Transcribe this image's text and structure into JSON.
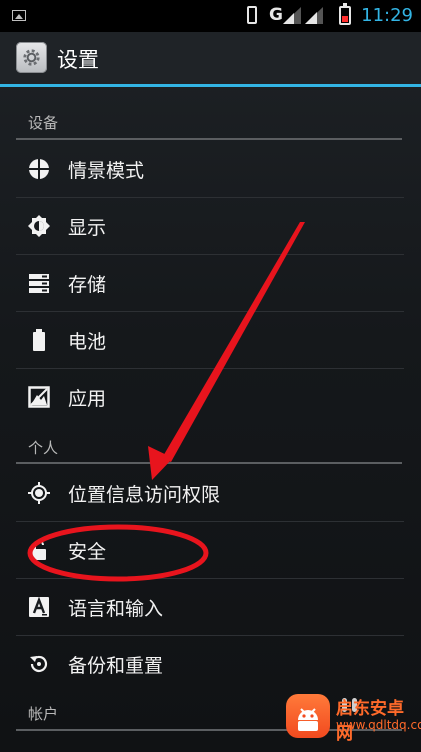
{
  "status_bar": {
    "time": "11:29",
    "network_label": "G",
    "time_color": "#33b5e5",
    "battery_level_fraction": 0.3
  },
  "action_bar": {
    "title": "设置",
    "accent_color": "#33b5e5"
  },
  "sections": [
    {
      "header": "设备",
      "items": [
        {
          "label": "情景模式",
          "icon": "profiles-icon"
        },
        {
          "label": "显示",
          "icon": "display-icon"
        },
        {
          "label": "存储",
          "icon": "storage-icon"
        },
        {
          "label": "电池",
          "icon": "battery-icon"
        },
        {
          "label": "应用",
          "icon": "apps-icon"
        }
      ]
    },
    {
      "header": "个人",
      "items": [
        {
          "label": "位置信息访问权限",
          "icon": "location-icon"
        },
        {
          "label": "安全",
          "icon": "lock-icon"
        },
        {
          "label": "语言和输入",
          "icon": "language-icon"
        },
        {
          "label": "备份和重置",
          "icon": "backup-icon"
        }
      ]
    },
    {
      "header": "帐户",
      "items": []
    }
  ],
  "annotations": {
    "color": "#e8141d"
  },
  "watermark": {
    "title": "启东安卓网",
    "url": "www.qdltdq.com",
    "color": "#ff6a2a"
  }
}
